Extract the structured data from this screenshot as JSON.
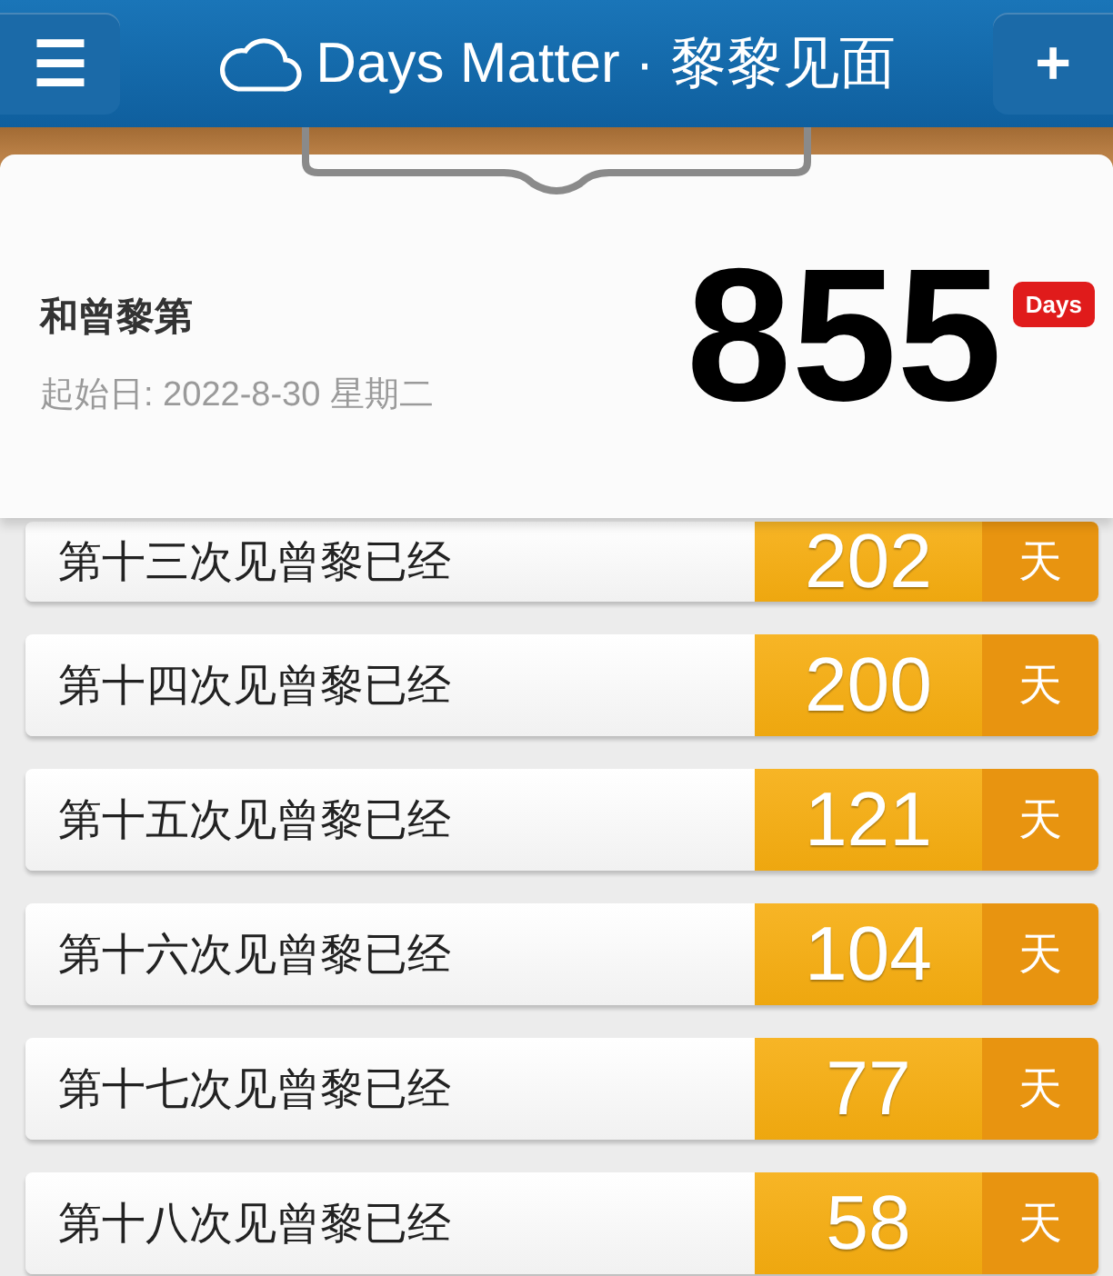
{
  "header": {
    "menu_icon": "☰",
    "title": "Days Matter · 黎黎见面",
    "add_icon": "+"
  },
  "summary": {
    "title": "和曾黎第",
    "start_date": "起始日: 2022-8-30 星期二",
    "count": "855",
    "unit_badge": "Days"
  },
  "events": [
    {
      "label": "第十三次见曾黎已经",
      "count": "202",
      "unit": "天"
    },
    {
      "label": "第十四次见曾黎已经",
      "count": "200",
      "unit": "天"
    },
    {
      "label": "第十五次见曾黎已经",
      "count": "121",
      "unit": "天"
    },
    {
      "label": "第十六次见曾黎已经",
      "count": "104",
      "unit": "天"
    },
    {
      "label": "第十七次见曾黎已经",
      "count": "77",
      "unit": "天"
    },
    {
      "label": "第十八次见曾黎已经",
      "count": "58",
      "unit": "天"
    }
  ]
}
